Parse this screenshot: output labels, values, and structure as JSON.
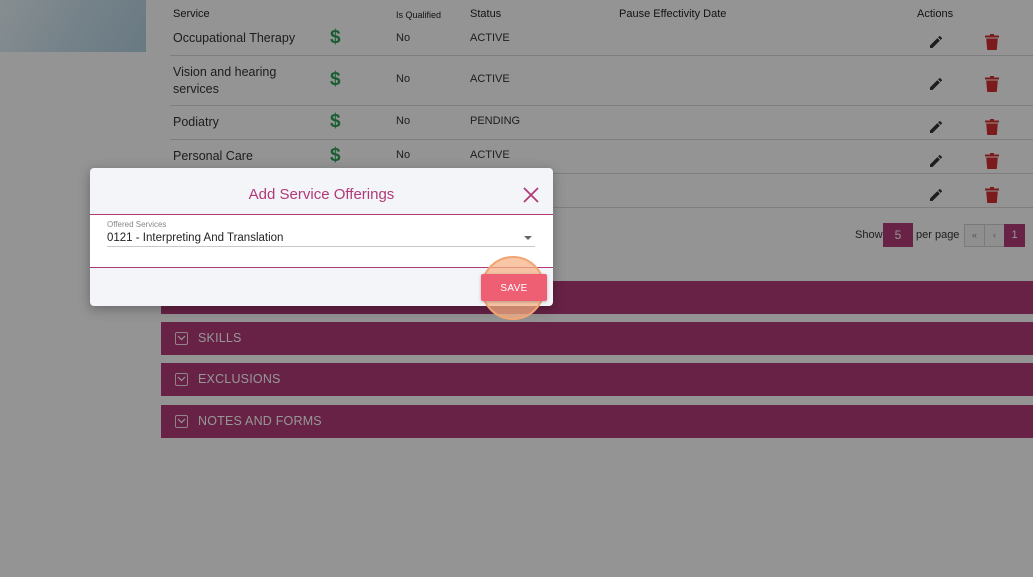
{
  "table": {
    "headers": {
      "service": "Service",
      "is_qualified": "Is Qualified",
      "status": "Status",
      "pause_effectivity_date": "Pause Effectivity Date",
      "actions": "Actions"
    },
    "rows": [
      {
        "service": "Occupational Therapy",
        "is_qualified": "No",
        "status": "ACTIVE"
      },
      {
        "service": "Vision and hearing services",
        "is_qualified": "No",
        "status": "ACTIVE"
      },
      {
        "service": "Podiatry",
        "is_qualified": "No",
        "status": "PENDING"
      },
      {
        "service": "Personal Care",
        "is_qualified": "No",
        "status": "ACTIVE"
      },
      {
        "service": "",
        "is_qualified": "",
        "status": ""
      }
    ],
    "billable_icon": "dollar-icon",
    "edit_icon": "pencil-icon",
    "delete_icon": "trash-icon"
  },
  "pagination": {
    "show_label": "Show",
    "page_size": "5",
    "per_page_label": "per page",
    "first": "«",
    "prev": "‹",
    "current_page": "1"
  },
  "sections": [
    {
      "label": ""
    },
    {
      "label": "SKILLS"
    },
    {
      "label": "EXCLUSIONS"
    },
    {
      "label": "NOTES AND FORMS"
    }
  ],
  "modal": {
    "title": "Add Service Offerings",
    "field_label": "Offered Services",
    "field_value": "0121 - Interpreting And Translation",
    "save_label": "SAVE"
  },
  "colors": {
    "accent": "#b03a77",
    "save": "#ee5f73",
    "billable": "#2f9e58",
    "delete": "#d32f2f"
  }
}
